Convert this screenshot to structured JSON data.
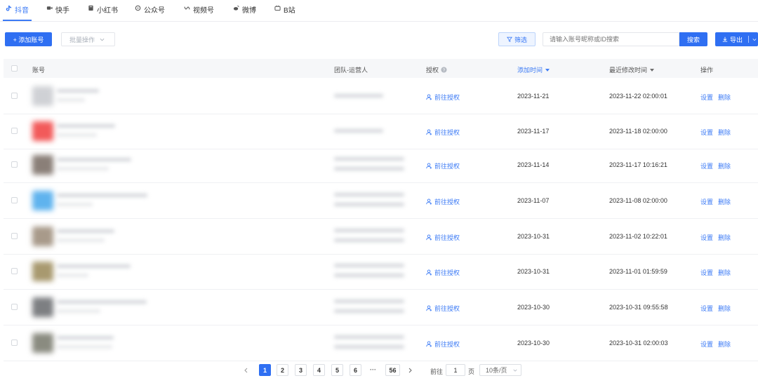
{
  "tabs": [
    {
      "label": "抖音",
      "icon": "douyin-icon",
      "active": true
    },
    {
      "label": "快手",
      "icon": "kuaishou-icon"
    },
    {
      "label": "小红书",
      "icon": "xiaohongshu-icon"
    },
    {
      "label": "公众号",
      "icon": "wechat-official-icon"
    },
    {
      "label": "视频号",
      "icon": "channels-icon"
    },
    {
      "label": "微博",
      "icon": "weibo-icon"
    },
    {
      "label": "B站",
      "icon": "bilibili-icon"
    }
  ],
  "toolbar": {
    "add_account": "+ 添加账号",
    "batch_ops": "批量操作",
    "filter": "筛选",
    "search_placeholder": "请输入账号昵称或ID搜索",
    "search_button": "搜索",
    "export_button": "导出"
  },
  "table": {
    "columns": {
      "account": "账号",
      "team": "团队-运营人",
      "auth": "授权",
      "added": "添加时间",
      "modified": "最近修改时间",
      "ops": "操作"
    },
    "auth_link": "前往授权",
    "op_settings": "设置",
    "op_delete": "删除",
    "rows": [
      {
        "added": "2023-11-21",
        "modified": "2023-11-22 02:00:01"
      },
      {
        "added": "2023-11-17",
        "modified": "2023-11-18 02:00:00"
      },
      {
        "added": "2023-11-14",
        "modified": "2023-11-17 10:16:21"
      },
      {
        "added": "2023-11-07",
        "modified": "2023-11-08 02:00:00"
      },
      {
        "added": "2023-10-31",
        "modified": "2023-11-02 10:22:01"
      },
      {
        "added": "2023-10-31",
        "modified": "2023-11-01 01:59:59"
      },
      {
        "added": "2023-10-30",
        "modified": "2023-10-31 09:55:58"
      },
      {
        "added": "2023-10-30",
        "modified": "2023-10-31 02:00:03"
      }
    ]
  },
  "pagination": {
    "pages": [
      "1",
      "2",
      "3",
      "4",
      "5",
      "6"
    ],
    "ellipsis": "···",
    "last": "56",
    "goto_label": "前往",
    "goto_value": "1",
    "page_suffix": "页",
    "page_size": "10条/页"
  },
  "colors": {
    "accent": "#2f6ff2",
    "avatars": [
      "#cfd1d5",
      "#f25a5a",
      "#8a7f78",
      "#5fb3ee",
      "#a89a8a",
      "#a8996f",
      "#7d7f82",
      "#8a8b80"
    ]
  }
}
